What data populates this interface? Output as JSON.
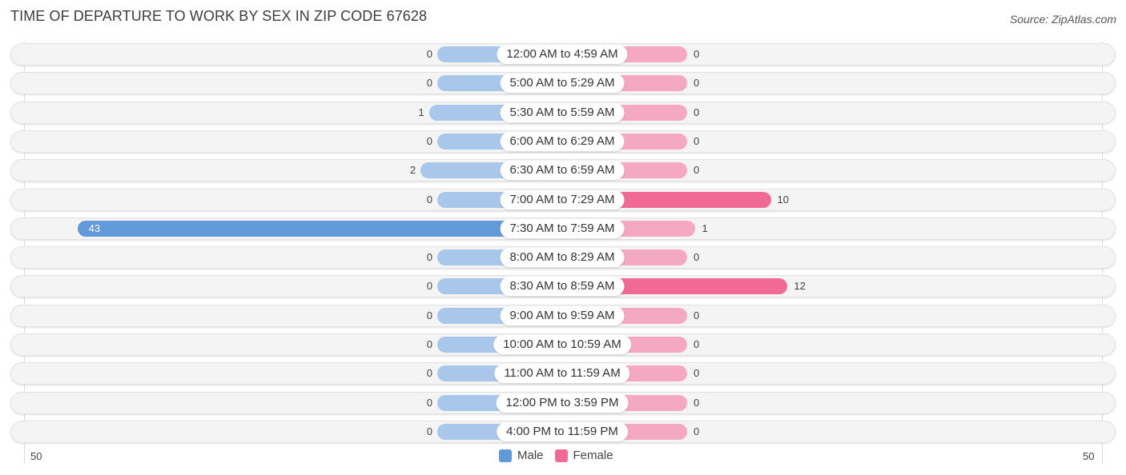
{
  "header": {
    "title": "TIME OF DEPARTURE TO WORK BY SEX IN ZIP CODE 67628",
    "source": "Source: ZipAtlas.com"
  },
  "colors": {
    "male": "#a9c7ea",
    "male_strong": "#6199d9",
    "female": "#f5a8c1",
    "female_strong": "#f06a94"
  },
  "chart_data": {
    "type": "bar",
    "orientation": "horizontal-diverging",
    "title": "TIME OF DEPARTURE TO WORK BY SEX IN ZIP CODE 67628",
    "categories": [
      "12:00 AM to 4:59 AM",
      "5:00 AM to 5:29 AM",
      "5:30 AM to 5:59 AM",
      "6:00 AM to 6:29 AM",
      "6:30 AM to 6:59 AM",
      "7:00 AM to 7:29 AM",
      "7:30 AM to 7:59 AM",
      "8:00 AM to 8:29 AM",
      "8:30 AM to 8:59 AM",
      "9:00 AM to 9:59 AM",
      "10:00 AM to 10:59 AM",
      "11:00 AM to 11:59 AM",
      "12:00 PM to 3:59 PM",
      "4:00 PM to 11:59 PM"
    ],
    "series": [
      {
        "name": "Male",
        "values": [
          0,
          0,
          1,
          0,
          2,
          0,
          43,
          0,
          0,
          0,
          0,
          0,
          0,
          0
        ]
      },
      {
        "name": "Female",
        "values": [
          0,
          0,
          0,
          0,
          0,
          10,
          1,
          0,
          12,
          0,
          0,
          0,
          0,
          0
        ]
      }
    ],
    "axis": {
      "left_label": "50",
      "right_label": "50",
      "range": [
        -50,
        50
      ]
    },
    "legend": {
      "position": "bottom-center",
      "entries": [
        "Male",
        "Female"
      ]
    }
  }
}
